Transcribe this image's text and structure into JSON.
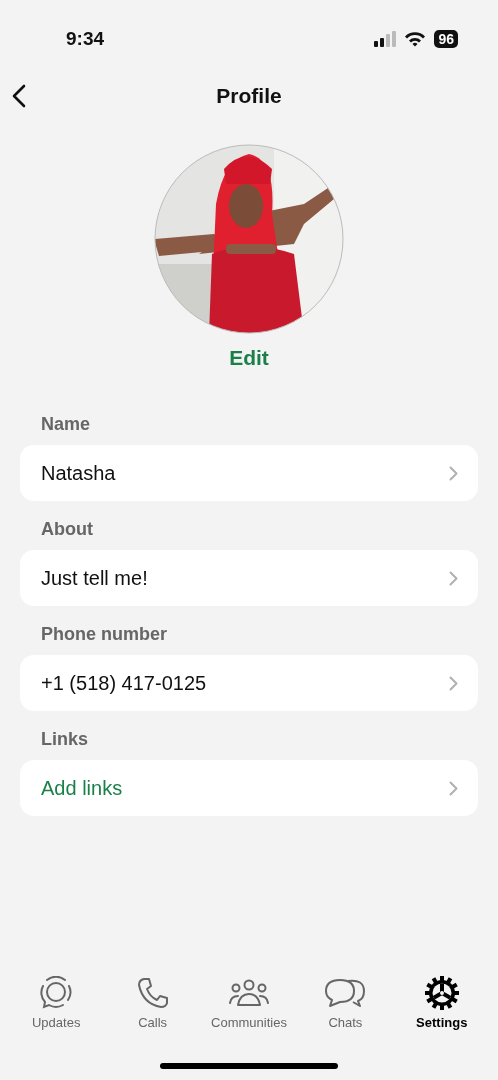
{
  "status_bar": {
    "time": "9:34",
    "battery": "96"
  },
  "header": {
    "title": "Profile"
  },
  "profile": {
    "edit": "Edit"
  },
  "sections": [
    {
      "label": "Name",
      "value": "Natasha",
      "kind": "text"
    },
    {
      "label": "About",
      "value": "Just tell me!",
      "kind": "text"
    },
    {
      "label": "Phone number",
      "value": "+1 (518) 417-0125",
      "kind": "text"
    },
    {
      "label": "Links",
      "value": "Add links",
      "kind": "link"
    }
  ],
  "tabs": [
    {
      "label": "Updates",
      "kind": "updates",
      "selected": false
    },
    {
      "label": "Calls",
      "kind": "calls",
      "selected": false
    },
    {
      "label": "Communities",
      "kind": "communities",
      "selected": false
    },
    {
      "label": "Chats",
      "kind": "chats",
      "selected": false
    },
    {
      "label": "Settings",
      "kind": "settings",
      "selected": true
    }
  ]
}
